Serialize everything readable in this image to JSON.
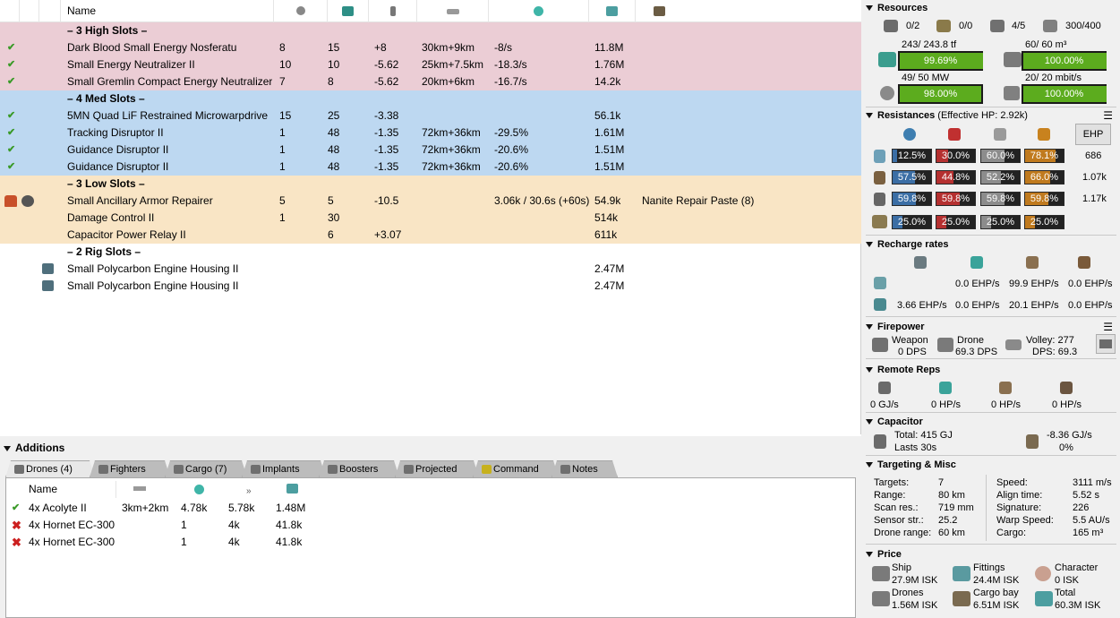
{
  "fitting": {
    "headers": {
      "name": "Name"
    },
    "sections": {
      "high": "– 3 High Slots –",
      "med": "– 4 Med Slots –",
      "low": "– 3 Low Slots –",
      "rig": "– 2 Rig Slots –"
    },
    "high": [
      {
        "name": "Dark Blood Small Energy Nosferatu",
        "cpu": "8",
        "pg": "15",
        "cap": "+8",
        "range": "30km+9km",
        "cap_use": "-8/s",
        "price": "11.8M"
      },
      {
        "name": "Small Energy Neutralizer II",
        "cpu": "10",
        "pg": "10",
        "cap": "-5.62",
        "range": "25km+7.5km",
        "cap_use": "-18.3/s",
        "price": "1.76M"
      },
      {
        "name": "Small Gremlin Compact Energy Neutralizer",
        "cpu": "7",
        "pg": "8",
        "cap": "-5.62",
        "range": "20km+6km",
        "cap_use": "-16.7/s",
        "price": "14.2k"
      }
    ],
    "med": [
      {
        "name": "5MN Quad LiF Restrained Microwarpdrive",
        "cpu": "15",
        "pg": "25",
        "cap": "-3.38",
        "range": "",
        "cap_use": "",
        "price": "56.1k"
      },
      {
        "name": "Tracking Disruptor II",
        "cpu": "1",
        "pg": "48",
        "cap": "-1.35",
        "range": "72km+36km",
        "cap_use": "-29.5%",
        "price": "1.61M"
      },
      {
        "name": "Guidance Disruptor II",
        "cpu": "1",
        "pg": "48",
        "cap": "-1.35",
        "range": "72km+36km",
        "cap_use": "-20.6%",
        "price": "1.51M"
      },
      {
        "name": "Guidance Disruptor II",
        "cpu": "1",
        "pg": "48",
        "cap": "-1.35",
        "range": "72km+36km",
        "cap_use": "-20.6%",
        "price": "1.51M"
      }
    ],
    "low": [
      {
        "name": "Small Ancillary Armor Repairer",
        "cpu": "5",
        "pg": "5",
        "cap": "-10.5",
        "range": "",
        "cap_use": "3.06k / 30.6s (+60s)",
        "price": "54.9k",
        "ammo": "Nanite Repair Paste (8)"
      },
      {
        "name": "Damage Control II",
        "cpu": "1",
        "pg": "30",
        "cap": "",
        "range": "",
        "cap_use": "",
        "price": "514k",
        "ammo": ""
      },
      {
        "name": "Capacitor Power Relay II",
        "cpu": "",
        "pg": "6",
        "cap": "+3.07",
        "range": "",
        "cap_use": "",
        "price": "611k",
        "ammo": ""
      }
    ],
    "rig": [
      {
        "name": "Small Polycarbon Engine Housing II",
        "price": "2.47M"
      },
      {
        "name": "Small Polycarbon Engine Housing II",
        "price": "2.47M"
      }
    ]
  },
  "additions": {
    "title": "Additions",
    "tabs": [
      "Drones (4)",
      "Fighters",
      "Cargo (7)",
      "Implants",
      "Boosters",
      "Projected",
      "Command",
      "Notes"
    ],
    "drone_headers": {
      "name": "Name"
    },
    "drones": [
      {
        "name": "4x Acolyte II",
        "range": "3km+2km",
        "c3": "4.78k",
        "c4": "5.78k",
        "price": "1.48M",
        "active": true
      },
      {
        "name": "4x Hornet EC-300",
        "range": "",
        "c3": "1",
        "c4": "4k",
        "price": "41.8k",
        "active": false
      },
      {
        "name": "4x Hornet EC-300",
        "range": "",
        "c3": "1",
        "c4": "4k",
        "price": "41.8k",
        "active": false
      }
    ]
  },
  "resources": {
    "title": "Resources",
    "hardpoints": {
      "turrets": "0/2",
      "launchers": "0/0",
      "drones_active": "4/5",
      "drone_bw_bay": "300/400"
    },
    "cpu": {
      "label": "243/ 243.8 tf",
      "pct": "99.69%",
      "fraction": 0.9969
    },
    "drone_bay": {
      "label": "60/ 60 m³",
      "pct": "100.00%",
      "fraction": 1.0
    },
    "pg": {
      "label": "49/ 50 MW",
      "pct": "98.00%",
      "fraction": 0.98
    },
    "bandwidth": {
      "label": "20/ 20 mbit/s",
      "pct": "100.00%",
      "fraction": 1.0
    }
  },
  "resistances": {
    "title": "Resistances",
    "ehp_text": "(Effective HP: 2.92k)",
    "ehp_button": "EHP",
    "rows": [
      {
        "values": [
          "12.5%",
          "30.0%",
          "60.0%",
          "78.1%"
        ],
        "fractions": [
          0.125,
          0.3,
          0.6,
          0.781
        ],
        "ehp": "686"
      },
      {
        "values": [
          "57.5%",
          "44.8%",
          "52.2%",
          "66.0%"
        ],
        "fractions": [
          0.575,
          0.448,
          0.522,
          0.66
        ],
        "ehp": "1.07k"
      },
      {
        "values": [
          "59.8%",
          "59.8%",
          "59.8%",
          "59.8%"
        ],
        "fractions": [
          0.598,
          0.598,
          0.598,
          0.598
        ],
        "ehp": "1.17k"
      },
      {
        "values": [
          "25.0%",
          "25.0%",
          "25.0%",
          "25.0%"
        ],
        "fractions": [
          0.25,
          0.25,
          0.25,
          0.25
        ],
        "ehp": ""
      }
    ],
    "colors": {
      "em": "#3b6ea5",
      "thermal": "#b53030",
      "kinetic": "#8c8c8c",
      "explosive": "#c07a1e"
    }
  },
  "recharge": {
    "title": "Recharge rates",
    "row1": [
      "",
      "0.0 EHP/s",
      "99.9 EHP/s",
      "0.0 EHP/s"
    ],
    "row2": [
      "3.66 EHP/s",
      "0.0 EHP/s",
      "20.1 EHP/s",
      "0.0 EHP/s"
    ]
  },
  "firepower": {
    "title": "Firepower",
    "weapon_label": "Weapon",
    "weapon_dps": "0 DPS",
    "drone_label": "Drone",
    "drone_dps": "69.3 DPS",
    "volley": "Volley: 277",
    "dps": "DPS: 69.3"
  },
  "remote_reps": {
    "title": "Remote Reps",
    "values": [
      "0 GJ/s",
      "0 HP/s",
      "0 HP/s",
      "0 HP/s"
    ]
  },
  "capacitor": {
    "title": "Capacitor",
    "total": "Total: 415 GJ",
    "lasts": "Lasts 30s",
    "delta": "-8.36 GJ/s",
    "pct": "0%"
  },
  "targeting": {
    "title": "Targeting & Misc",
    "left": [
      {
        "k": "Targets:",
        "v": "7"
      },
      {
        "k": "Range:",
        "v": "80 km"
      },
      {
        "k": "Scan res.:",
        "v": "719 mm"
      },
      {
        "k": "Sensor str.:",
        "v": "25.2"
      },
      {
        "k": "Drone range:",
        "v": "60 km"
      }
    ],
    "right": [
      {
        "k": "Speed:",
        "v": "3111 m/s"
      },
      {
        "k": "Align time:",
        "v": "5.52 s"
      },
      {
        "k": "Signature:",
        "v": "226"
      },
      {
        "k": "Warp Speed:",
        "v": "5.5 AU/s"
      },
      {
        "k": "Cargo:",
        "v": "165 m³"
      }
    ]
  },
  "price": {
    "title": "Price",
    "ship_label": "Ship",
    "ship": "27.9M ISK",
    "fittings_label": "Fittings",
    "fittings": "24.4M ISK",
    "character_label": "Character",
    "character": "0 ISK",
    "drones_label": "Drones",
    "drones": "1.56M ISK",
    "cargo_label": "Cargo bay",
    "cargo": "6.51M ISK",
    "total_label": "Total",
    "total": "60.3M ISK"
  }
}
